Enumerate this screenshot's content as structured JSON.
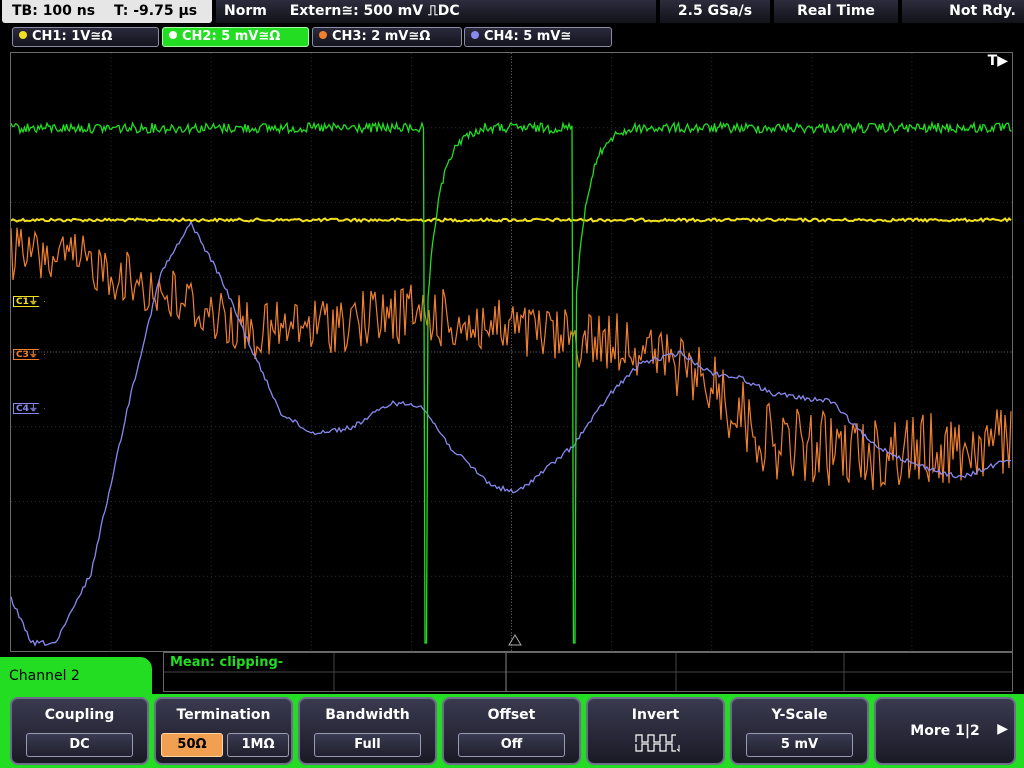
{
  "topbar": {
    "timebase": "TB: 100 ns",
    "trigger_time": "T: -9.75 µs",
    "trigger_mode": "Norm",
    "trigger_info": "Extern≅: 500 mV ⎍DC",
    "sample_rate": "2.5 GSa/s",
    "acquisition": "Real Time",
    "status": "Not Rdy."
  },
  "channel_tabs": [
    {
      "label": "CH1: 1V≅Ω",
      "color": "#f0e020"
    },
    {
      "label": "CH2: 5 mV≅Ω",
      "color": "#22dd22"
    },
    {
      "label": "CH3: 2 mV≅Ω",
      "color": "#f08030"
    },
    {
      "label": "CH4: 5 mV≅",
      "color": "#8888ee"
    }
  ],
  "markers": {
    "c1": "C1⏚",
    "c3": "C3⏚",
    "c4": "C4⏚",
    "trigger": "T▶"
  },
  "measurement": "Mean: clipping-",
  "menu": {
    "title": "Channel 2",
    "coupling": {
      "label": "Coupling",
      "value": "DC"
    },
    "termination": {
      "label": "Termination",
      "options": [
        "50Ω",
        "1MΩ"
      ],
      "selected": "50Ω"
    },
    "bandwidth": {
      "label": "Bandwidth",
      "value": "Full"
    },
    "offset": {
      "label": "Offset",
      "value": "Off"
    },
    "invert": {
      "label": "Invert",
      "icon": "invert-square-wave-icon"
    },
    "yscale": {
      "label": "Y-Scale",
      "value": "5 mV"
    },
    "more": {
      "label": "More 1|2"
    }
  }
}
